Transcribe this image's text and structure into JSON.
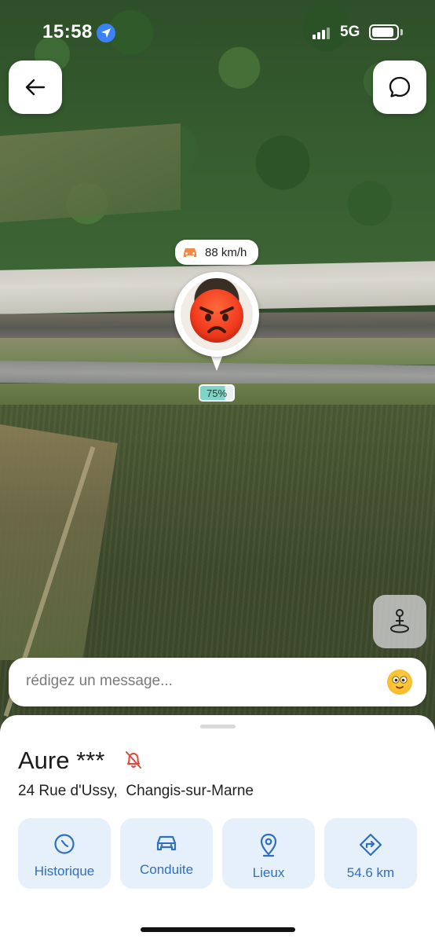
{
  "status": {
    "time": "15:58",
    "network": "5G",
    "battery_level": 0.9
  },
  "top_bar": {
    "back_icon": "arrow-left-icon",
    "chat_icon": "chat-bubble-icon"
  },
  "marker": {
    "speed": "88 km/h",
    "speed_icon": "car-icon",
    "avatar_emoji": "angry-face",
    "battery": "75%",
    "battery_level": 0.75
  },
  "message_bar": {
    "placeholder": "rédigez un message...",
    "emoji_icon": "smiley-icon"
  },
  "sheet": {
    "name": "Aure ***",
    "notification_icon": "bell-off-icon",
    "address": "24 Rue d'Ussy,  Changis-sur-Marne",
    "actions": [
      {
        "label": "Historique",
        "icon": "history-icon"
      },
      {
        "label": "Conduite",
        "icon": "car-icon"
      },
      {
        "label": "Lieux",
        "icon": "location-pin-icon"
      },
      {
        "label": "54.6 km",
        "icon": "route-icon"
      }
    ]
  },
  "colors": {
    "accent": "#2f6fbf",
    "action_bg": "#e6f0fb",
    "battery_fill": "#7ed4c6",
    "alert_red": "#e0483e",
    "location_blue": "#3a82f7"
  }
}
